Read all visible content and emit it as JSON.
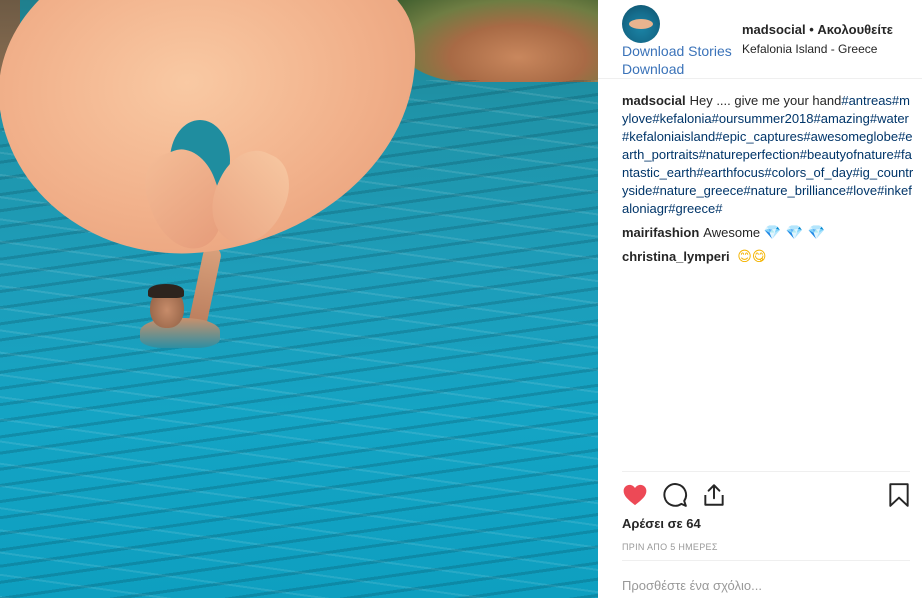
{
  "header": {
    "username": "madsocial",
    "separator": "•",
    "follow_status": "Ακολουθείτε",
    "location": "Kefalonia Island - Greece",
    "download_stories": "Download Stories",
    "download": "Download"
  },
  "caption": {
    "username": "madsocial",
    "text": "Hey .... give me your hand",
    "hashtags": "#antreas#mylove#kefalonia#oursummer2018#amazing#water#kefaloniaisland#epic_captures#awesomeglobe#earth_portraits#natureperfection#beautyofnature#fantastic_earth#earthfocus#colors_of_day#ig_countryside#nature_greece#nature_brilliance#love#inkefaloniagr#greece#"
  },
  "comments": [
    {
      "username": "mairifashion",
      "text": "Awesome",
      "emoji": "💎 💎 💎"
    },
    {
      "username": "christina_lymperi",
      "text": "",
      "emoji": "😊😋"
    }
  ],
  "actions": {
    "like_icon": "heart-icon",
    "comment_icon": "comment-icon",
    "share_icon": "share-icon",
    "save_icon": "bookmark-icon",
    "heart_color": "#ed4956"
  },
  "likes": "Αρέσει σε 64",
  "time_ago": "ΠΡΙΝ ΑΠΟ 5 ΗΜΕΡΕΣ",
  "add_comment_placeholder": "Προσθέστε ένα σχόλιο..."
}
